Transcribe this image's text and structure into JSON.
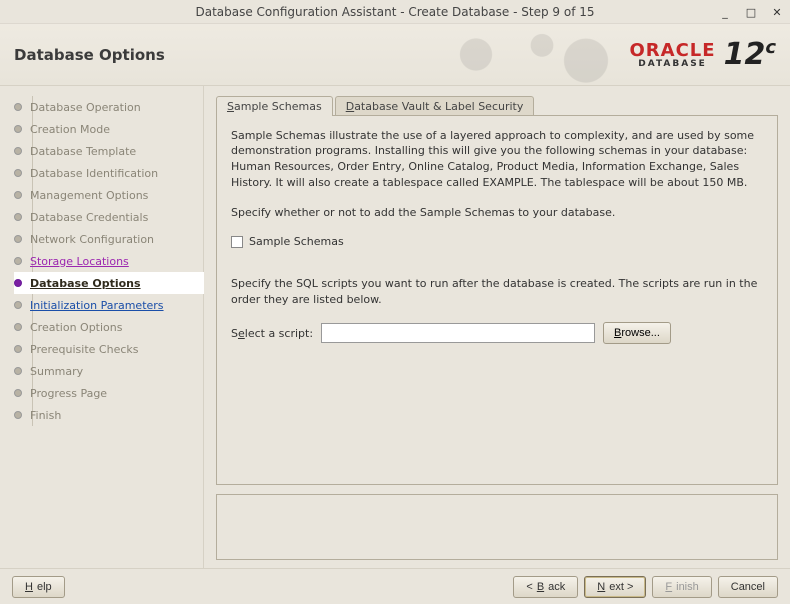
{
  "window": {
    "title": "Database Configuration Assistant - Create Database - Step 9 of 15"
  },
  "header": {
    "title": "Database Options",
    "logo_brand": "ORACLE",
    "logo_sub": "DATABASE",
    "logo_version": "12",
    "logo_suffix": "c"
  },
  "steps": [
    {
      "label": "Database Operation"
    },
    {
      "label": "Creation Mode"
    },
    {
      "label": "Database Template"
    },
    {
      "label": "Database Identification"
    },
    {
      "label": "Management Options"
    },
    {
      "label": "Database Credentials"
    },
    {
      "label": "Network Configuration"
    },
    {
      "label": "Storage Locations"
    },
    {
      "label": "Database Options"
    },
    {
      "label": "Initialization Parameters"
    },
    {
      "label": "Creation Options"
    },
    {
      "label": "Prerequisite Checks"
    },
    {
      "label": "Summary"
    },
    {
      "label": "Progress Page"
    },
    {
      "label": "Finish"
    }
  ],
  "tabs": {
    "sample": {
      "prefix": "S",
      "rest": "ample Schemas"
    },
    "vault": {
      "prefix": "D",
      "rest": "atabase Vault & Label Security"
    }
  },
  "panel": {
    "desc": "Sample Schemas illustrate the use of a layered approach to complexity, and are used by some demonstration programs. Installing this will give you the following schemas in your database: Human Resources, Order Entry, Online Catalog, Product Media, Information Exchange, Sales History. It will also create a tablespace called EXAMPLE. The tablespace will be about 150 MB.",
    "specify": "Specify whether or not to add the Sample Schemas to your database.",
    "checkbox_label": "Sample Schemas",
    "scripts_help": "Specify the SQL scripts you want to run after the database is created. The scripts are run in the order they are listed below.",
    "script_label_pre": "S",
    "script_label_u": "e",
    "script_label_post": "lect a script:",
    "script_value": "",
    "browse_u": "B",
    "browse_rest": "rowse..."
  },
  "footer": {
    "help_u": "H",
    "help_rest": "elp",
    "back_pre": "< ",
    "back_u": "B",
    "back_rest": "ack",
    "next_u": "N",
    "next_rest": "ext >",
    "finish_u": "F",
    "finish_rest": "inish",
    "cancel": "Cancel"
  }
}
